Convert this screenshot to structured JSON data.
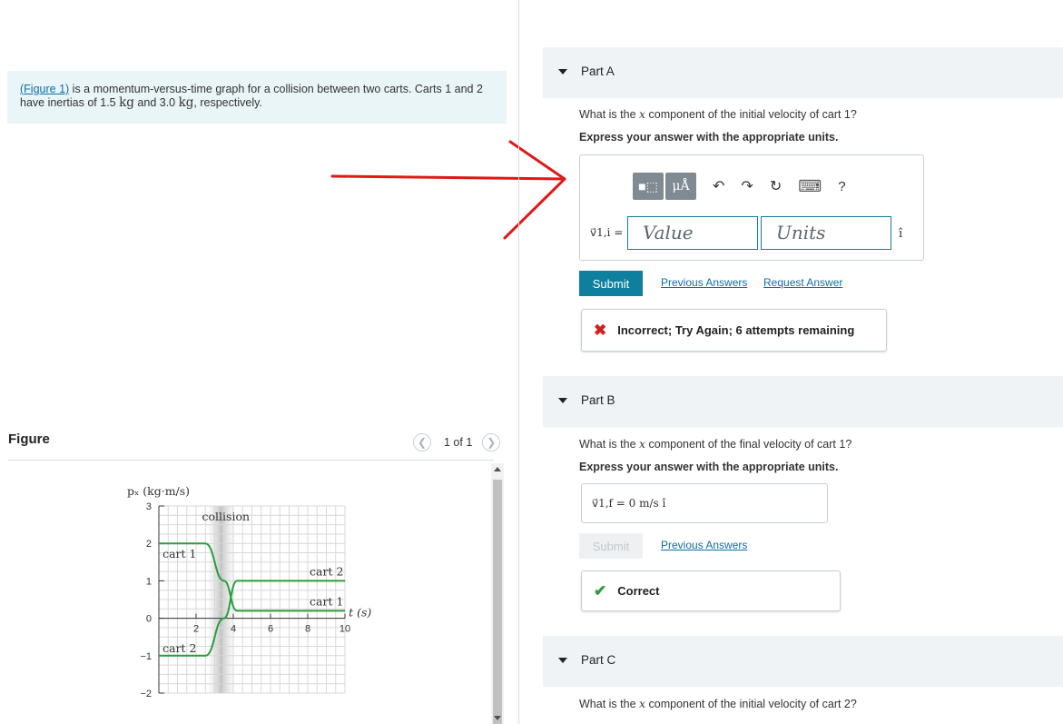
{
  "intro": {
    "figure_link": "(Figure 1)",
    "text_pre": " is a momentum-versus-time graph for a collision between two carts. Carts 1 and 2 have inertias of 1.5 ",
    "kg1": "kg",
    "text_mid": " and 3.0 ",
    "kg2": "kg",
    "text_post": ", respectively."
  },
  "figure": {
    "title": "Figure",
    "pager": "1 of 1"
  },
  "chart_data": {
    "type": "line",
    "ylabel": "p_x (kg·m/s)",
    "xlabel": "t (s)",
    "xlim": [
      0,
      10
    ],
    "ylim": [
      -2,
      3
    ],
    "xticks": [
      "2",
      "4",
      "6",
      "8",
      "10"
    ],
    "yticks": [
      "3",
      "2",
      "1",
      "0",
      "−1",
      "−2"
    ],
    "annotations": [
      "collision",
      "cart 1",
      "cart 2",
      "cart 2",
      "cart 1"
    ],
    "grid": true,
    "series": [
      {
        "name": "cart 1",
        "x": [
          0,
          2.5,
          3.5,
          4.2,
          10
        ],
        "y": [
          2,
          2,
          1,
          0.2,
          0.2
        ]
      },
      {
        "name": "cart 2",
        "x": [
          0,
          2.5,
          3.5,
          4.2,
          10
        ],
        "y": [
          -1,
          -1,
          0,
          1,
          1
        ]
      }
    ]
  },
  "partA": {
    "label": "Part A",
    "question_pre": "What is the ",
    "question_var": "x",
    "question_post": " component of the initial velocity of cart 1?",
    "instruction": "Express your answer with the appropriate units.",
    "toolbar": {
      "templates": "■⬚",
      "units": "μÅ",
      "undo": "↶",
      "redo": "↷",
      "reset": "↻",
      "keyboard": "⌨",
      "help": "?"
    },
    "variable": "v⃗1,i =",
    "value_placeholder": "Value",
    "units_placeholder": "Units",
    "unit_vector": "î",
    "submit": "Submit",
    "previous_answers": "Previous Answers",
    "request_answer": "Request Answer",
    "feedback": "Incorrect; Try Again; 6 attempts remaining"
  },
  "partB": {
    "label": "Part B",
    "question_pre": "What is the ",
    "question_var": "x",
    "question_post": " component of the final velocity of cart 1?",
    "instruction": "Express your answer with the appropriate units.",
    "answer": "v⃗1,f = 0 m/s î",
    "submit": "Submit",
    "previous_answers": "Previous Answers",
    "feedback": "Correct"
  },
  "partC": {
    "label": "Part C",
    "question_pre": "What is the ",
    "question_var": "x",
    "question_post": " component of the initial velocity of cart 2?"
  },
  "colors": {
    "accent": "#0f7f9f",
    "line": "#2a9d3c",
    "error": "#d21f1f",
    "success": "#2a9d3c",
    "arrow": "#e01818"
  }
}
